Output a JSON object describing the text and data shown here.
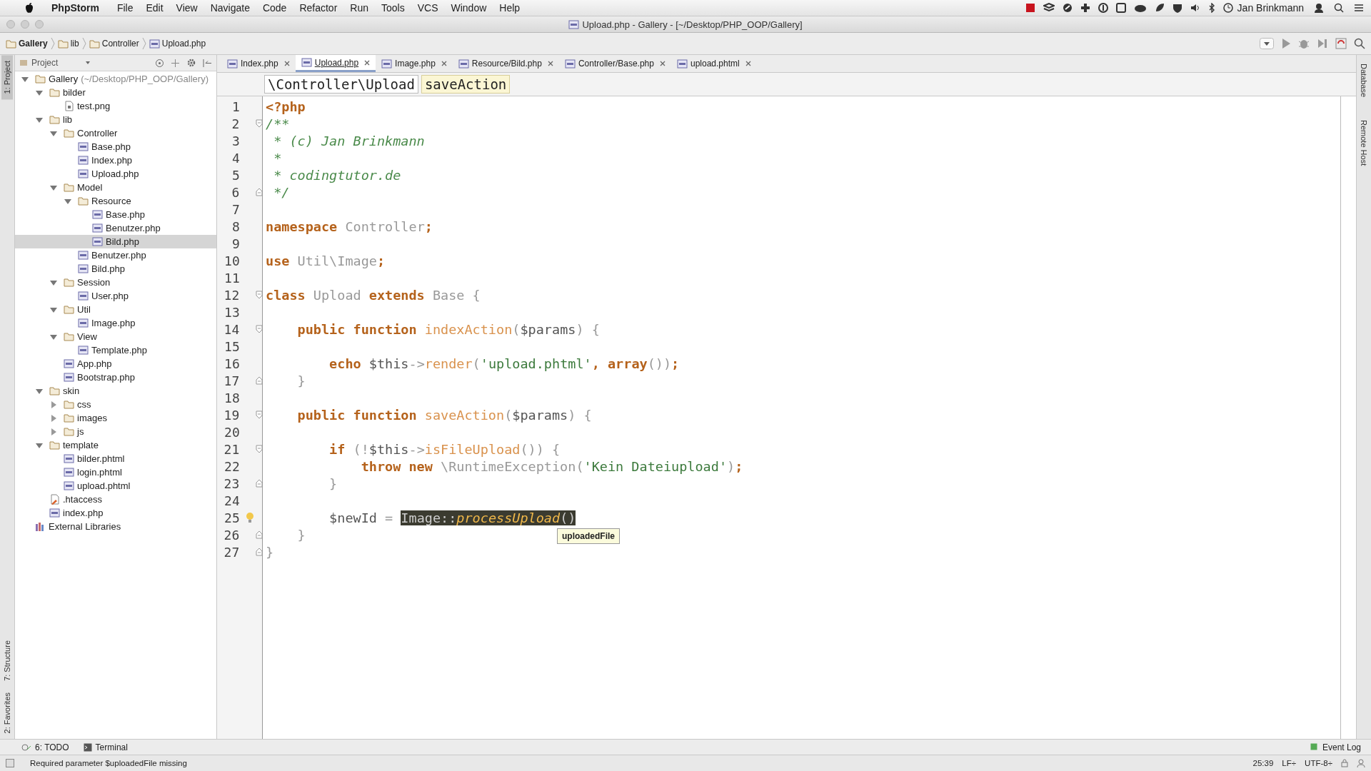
{
  "menu_bar": {
    "app": "PhpStorm",
    "items": [
      "File",
      "Edit",
      "View",
      "Navigate",
      "Code",
      "Refactor",
      "Run",
      "Tools",
      "VCS",
      "Window",
      "Help"
    ],
    "user": "Jan Brinkmann"
  },
  "window": {
    "title": "Upload.php - Gallery - [~/Desktop/PHP_OOP/Gallery]"
  },
  "breadcrumbs": [
    {
      "label": "Gallery",
      "kind": "folder"
    },
    {
      "label": "lib",
      "kind": "folder"
    },
    {
      "label": "Controller",
      "kind": "folder"
    },
    {
      "label": "Upload.php",
      "kind": "php"
    }
  ],
  "left_tool_windows": [
    {
      "label": "1: Project",
      "selected": true
    },
    {
      "label": "7: Structure",
      "selected": false
    },
    {
      "label": "2: Favorites",
      "selected": false
    }
  ],
  "right_tool_windows": [
    "Database",
    "Remote Host"
  ],
  "project_panel": {
    "title": "Project",
    "tree": [
      {
        "label": "Gallery",
        "path": "(~/Desktop/PHP_OOP/Gallery)",
        "kind": "folder",
        "expanded": true,
        "selected": false,
        "children": [
          {
            "label": "bilder",
            "kind": "folder",
            "expanded": true,
            "selected": false,
            "children": [
              {
                "label": "test.png",
                "kind": "image",
                "selected": false
              }
            ]
          },
          {
            "label": "lib",
            "kind": "folder",
            "expanded": true,
            "selected": false,
            "children": [
              {
                "label": "Controller",
                "kind": "folder",
                "expanded": true,
                "selected": false,
                "children": [
                  {
                    "label": "Base.php",
                    "kind": "php",
                    "selected": false
                  },
                  {
                    "label": "Index.php",
                    "kind": "php",
                    "selected": false
                  },
                  {
                    "label": "Upload.php",
                    "kind": "php",
                    "selected": false
                  }
                ]
              },
              {
                "label": "Model",
                "kind": "folder",
                "expanded": true,
                "selected": false,
                "children": [
                  {
                    "label": "Resource",
                    "kind": "folder",
                    "expanded": true,
                    "selected": false,
                    "children": [
                      {
                        "label": "Base.php",
                        "kind": "php",
                        "selected": false
                      },
                      {
                        "label": "Benutzer.php",
                        "kind": "php",
                        "selected": false
                      },
                      {
                        "label": "Bild.php",
                        "kind": "php",
                        "selected": true
                      }
                    ]
                  },
                  {
                    "label": "Benutzer.php",
                    "kind": "php",
                    "selected": false
                  },
                  {
                    "label": "Bild.php",
                    "kind": "php",
                    "selected": false
                  }
                ]
              },
              {
                "label": "Session",
                "kind": "folder",
                "expanded": true,
                "selected": false,
                "children": [
                  {
                    "label": "User.php",
                    "kind": "php",
                    "selected": false
                  }
                ]
              },
              {
                "label": "Util",
                "kind": "folder",
                "expanded": true,
                "selected": false,
                "children": [
                  {
                    "label": "Image.php",
                    "kind": "php",
                    "selected": false
                  }
                ]
              },
              {
                "label": "View",
                "kind": "folder",
                "expanded": true,
                "selected": false,
                "children": [
                  {
                    "label": "Template.php",
                    "kind": "php",
                    "selected": false
                  }
                ]
              },
              {
                "label": "App.php",
                "kind": "php",
                "selected": false
              },
              {
                "label": "Bootstrap.php",
                "kind": "php",
                "selected": false
              }
            ]
          },
          {
            "label": "skin",
            "kind": "folder",
            "expanded": true,
            "selected": false,
            "children": [
              {
                "label": "css",
                "kind": "folder",
                "expanded": false,
                "selected": false
              },
              {
                "label": "images",
                "kind": "folder",
                "expanded": false,
                "selected": false
              },
              {
                "label": "js",
                "kind": "folder",
                "expanded": false,
                "selected": false
              }
            ]
          },
          {
            "label": "template",
            "kind": "folder",
            "expanded": true,
            "selected": false,
            "children": [
              {
                "label": "bilder.phtml",
                "kind": "php",
                "selected": false
              },
              {
                "label": "login.phtml",
                "kind": "php",
                "selected": false
              },
              {
                "label": "upload.phtml",
                "kind": "php",
                "selected": false
              }
            ]
          },
          {
            "label": ".htaccess",
            "kind": "config",
            "selected": false
          },
          {
            "label": "index.php",
            "kind": "php",
            "selected": false
          }
        ]
      },
      {
        "label": "External Libraries",
        "kind": "library",
        "selected": false
      }
    ]
  },
  "tabs": [
    {
      "label": "Index.php",
      "selected": false
    },
    {
      "label": "Upload.php",
      "selected": true
    },
    {
      "label": "Image.php",
      "selected": false
    },
    {
      "label": "Resource/Bild.php",
      "selected": false
    },
    {
      "label": "Controller/Base.php",
      "selected": false
    },
    {
      "label": "upload.phtml",
      "selected": false
    }
  ],
  "editor": {
    "path": [
      {
        "label": "\\Controller\\Upload",
        "kind": "class"
      },
      {
        "label": "saveAction",
        "kind": "method"
      }
    ],
    "lines": [
      {
        "number": "1",
        "fold_start": false,
        "fold_end": false,
        "bulb": false,
        "tokens": [
          {
            "kind": "tag",
            "text": "<?php"
          }
        ]
      },
      {
        "number": "2",
        "fold_start": true,
        "fold_end": false,
        "bulb": false,
        "tokens": [
          {
            "kind": "comment",
            "text": "/**"
          }
        ]
      },
      {
        "number": "3",
        "fold_start": false,
        "fold_end": false,
        "bulb": false,
        "tokens": [
          {
            "kind": "comment",
            "text": " * (c) Jan Brinkmann"
          }
        ]
      },
      {
        "number": "4",
        "fold_start": false,
        "fold_end": false,
        "bulb": false,
        "tokens": [
          {
            "kind": "comment",
            "text": " *"
          }
        ]
      },
      {
        "number": "5",
        "fold_start": false,
        "fold_end": false,
        "bulb": false,
        "tokens": [
          {
            "kind": "comment",
            "text": " * codingtutor.de"
          }
        ]
      },
      {
        "number": "6",
        "fold_start": false,
        "fold_end": true,
        "bulb": false,
        "tokens": [
          {
            "kind": "comment",
            "text": " */"
          }
        ]
      },
      {
        "number": "7",
        "fold_start": false,
        "fold_end": false,
        "bulb": false
      },
      {
        "number": "8",
        "fold_start": false,
        "fold_end": false,
        "bulb": false,
        "tokens": [
          {
            "kind": "kw",
            "text": "namespace "
          },
          {
            "kind": "ident",
            "text": "Controller"
          },
          {
            "kind": "kw",
            "text": ";"
          }
        ]
      },
      {
        "number": "9",
        "fold_start": false,
        "fold_end": false,
        "bulb": false
      },
      {
        "number": "10",
        "fold_start": false,
        "fold_end": false,
        "bulb": false,
        "tokens": [
          {
            "kind": "kw",
            "text": "use "
          },
          {
            "kind": "ident",
            "text": "Util\\Image"
          },
          {
            "kind": "kw",
            "text": ";"
          }
        ]
      },
      {
        "number": "11",
        "fold_start": false,
        "fold_end": false,
        "bulb": false
      },
      {
        "number": "12",
        "fold_start": true,
        "fold_end": false,
        "bulb": false,
        "tokens": [
          {
            "kind": "kw",
            "text": "class "
          },
          {
            "kind": "ident",
            "text": "Upload "
          },
          {
            "kind": "kw",
            "text": "extends "
          },
          {
            "kind": "ident",
            "text": "Base {"
          }
        ]
      },
      {
        "number": "13",
        "fold_start": false,
        "fold_end": false,
        "bulb": false
      },
      {
        "number": "14",
        "fold_start": true,
        "fold_end": false,
        "bulb": false,
        "tokens": [
          {
            "kind": "kw",
            "text": "    public function "
          },
          {
            "kind": "fn",
            "text": "indexAction"
          },
          {
            "kind": "punct",
            "text": "("
          },
          {
            "kind": "var",
            "text": "$params"
          },
          {
            "kind": "punct",
            "text": ") {"
          }
        ]
      },
      {
        "number": "15",
        "fold_start": false,
        "fold_end": false,
        "bulb": false
      },
      {
        "number": "16",
        "fold_start": false,
        "fold_end": false,
        "bulb": false,
        "tokens": [
          {
            "kind": "kw",
            "text": "        echo "
          },
          {
            "kind": "var",
            "text": "$this"
          },
          {
            "kind": "punct",
            "text": "->"
          },
          {
            "kind": "fn",
            "text": "render"
          },
          {
            "kind": "punct",
            "text": "("
          },
          {
            "kind": "str",
            "text": "'upload.phtml'"
          },
          {
            "kind": "kw",
            "text": ", array"
          },
          {
            "kind": "punct",
            "text": "())"
          },
          {
            "kind": "kw",
            "text": ";"
          }
        ]
      },
      {
        "number": "17",
        "fold_start": false,
        "fold_end": true,
        "bulb": false,
        "tokens": [
          {
            "kind": "punct",
            "text": "    }"
          }
        ]
      },
      {
        "number": "18",
        "fold_start": false,
        "fold_end": false,
        "bulb": false
      },
      {
        "number": "19",
        "fold_start": true,
        "fold_end": false,
        "bulb": false,
        "tokens": [
          {
            "kind": "kw",
            "text": "    public function "
          },
          {
            "kind": "fn",
            "text": "saveAction"
          },
          {
            "kind": "punct",
            "text": "("
          },
          {
            "kind": "var",
            "text": "$params"
          },
          {
            "kind": "punct",
            "text": ") {"
          }
        ]
      },
      {
        "number": "20",
        "fold_start": false,
        "fold_end": false,
        "bulb": false
      },
      {
        "number": "21",
        "fold_start": true,
        "fold_end": false,
        "bulb": false,
        "tokens": [
          {
            "kind": "kw",
            "text": "        if "
          },
          {
            "kind": "punct",
            "text": "(!"
          },
          {
            "kind": "var",
            "text": "$this"
          },
          {
            "kind": "punct",
            "text": "->"
          },
          {
            "kind": "fn",
            "text": "isFileUpload"
          },
          {
            "kind": "punct",
            "text": "()) {"
          }
        ]
      },
      {
        "number": "22",
        "fold_start": false,
        "fold_end": false,
        "bulb": false,
        "tokens": [
          {
            "kind": "kw",
            "text": "            throw new "
          },
          {
            "kind": "ident",
            "text": "\\RuntimeException"
          },
          {
            "kind": "punct",
            "text": "("
          },
          {
            "kind": "str",
            "text": "'Kein Dateiupload'"
          },
          {
            "kind": "punct",
            "text": ")"
          },
          {
            "kind": "kw",
            "text": ";"
          }
        ]
      },
      {
        "number": "23",
        "fold_start": false,
        "fold_end": true,
        "bulb": false,
        "tokens": [
          {
            "kind": "punct",
            "text": "        }"
          }
        ]
      },
      {
        "number": "24",
        "fold_start": false,
        "fold_end": false,
        "bulb": false
      },
      {
        "number": "25",
        "fold_start": false,
        "fold_end": false,
        "bulb": true,
        "tokens": [
          {
            "kind": "var",
            "text": "        $newId"
          },
          {
            "kind": "punct",
            "text": " = "
          },
          {
            "kind": "sel",
            "text": "Image::"
          },
          {
            "kind": "selfn",
            "text": "processUpload"
          },
          {
            "kind": "sel",
            "text": "()"
          }
        ],
        "tooltip": "uploadedFile"
      },
      {
        "number": "26",
        "fold_start": false,
        "fold_end": true,
        "bulb": false,
        "tokens": [
          {
            "kind": "punct",
            "text": "    }"
          }
        ]
      },
      {
        "number": "27",
        "fold_start": false,
        "fold_end": true,
        "bulb": false,
        "tokens": [
          {
            "kind": "punct",
            "text": "}"
          }
        ]
      }
    ]
  },
  "bottom_tool_windows": [
    {
      "label": "6: TODO",
      "kind": "todo"
    },
    {
      "label": "Terminal",
      "kind": "terminal"
    }
  ],
  "event_log": "Event Log",
  "status_bar": {
    "message": "Required parameter $uploadedFile missing",
    "position": "25:39",
    "line_separator": "LF÷",
    "encoding": "UTF-8÷"
  }
}
